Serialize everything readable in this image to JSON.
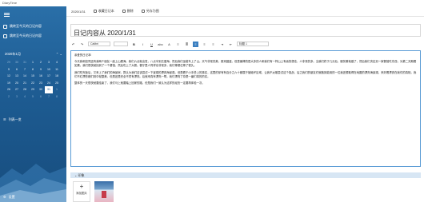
{
  "window": {
    "title": "DiaryTime"
  },
  "sidebar": {
    "items": [
      {
        "label": "跳转至今天的日记内容"
      },
      {
        "label": "跳转至今天的日记内容"
      }
    ],
    "calendar": {
      "month": "2020年1月",
      "days": [
        "29",
        "30",
        "31",
        "1",
        "2",
        "3",
        "4",
        "5",
        "6",
        "7",
        "8",
        "9",
        "10",
        "11",
        "12",
        "13",
        "14",
        "15",
        "16",
        "17",
        "18",
        "19",
        "20",
        "21",
        "22",
        "23",
        "24",
        "25",
        "26",
        "27",
        "28",
        "29",
        "30",
        "31",
        "1",
        "2",
        "3",
        "4",
        "5",
        "6",
        "7",
        "8"
      ],
      "selected_index": 33
    },
    "list_view": "列表一览",
    "settings": "设置"
  },
  "toolbar_top": {
    "date": "2020/1/31",
    "items": [
      "收藏日记本",
      "删除",
      "另存为图"
    ]
  },
  "entry": {
    "title": "日记内容从 2020/1/31"
  },
  "format": {
    "font": "Calibri",
    "style_label": "标题 1"
  },
  "editor": {
    "paragraphs": [
      "亲爱的日记本!",
      "今天我和如同还有我两个朋友一起上山看海。我们六点就出发，八点半到达爱海。然后我们坐缆车上了山。天气非常完美，蔚岚碧蓝，但是最棒的是大多的人和我们有一样山上有喜的想法，人非常的多。当我们终于几分后，服务第就做了，然后我们决定另一家餐馆吃东西，为第二天期看如果。我们很快就找到了一个餐馆，然后吃上了大餐。餐厅里人同样也非常多，我们等餐位等了很久。",
      "我们吃完饭后，又来上了我们的海景房。算认为我们这该尝试一下景观的漂亮海景观。但是看于小手些上的事实，这里的却有有百分之六十都属于被破坏区域，让我不太敢尝试这个挑战，后之我们的朋友们就跑到能用的一位我还想取得在地图的漂亮海景观。来好看漂亮在我们的真相，我们不红漂些都们到中轻整美，但是还是完全不然有漂亮。后就来真有漂亮一帮。我们漂亮了总是一番们真的的实。",
      "整体的一天很快就要结束了，我们马上就要踏上回家的路，但是我们一致认为这样的经历一定要再体验一次。"
    ]
  },
  "images": {
    "section_label": "印象",
    "add_label": "添加图片"
  }
}
